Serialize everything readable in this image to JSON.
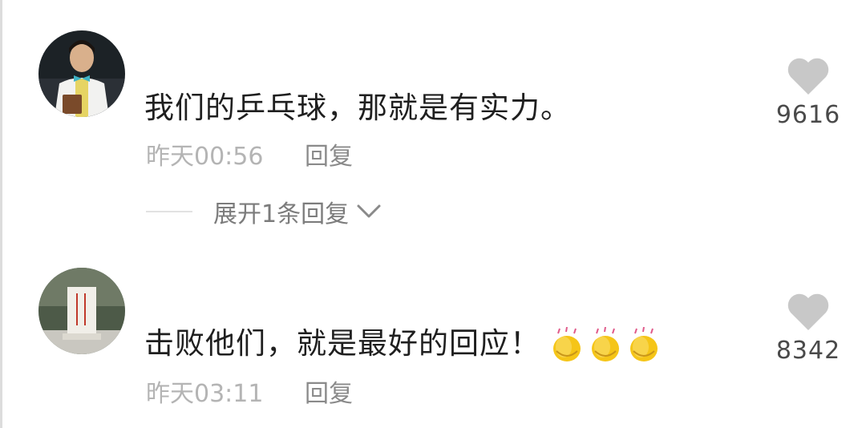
{
  "comments": [
    {
      "text": "我们的乒乓球，那就是有实力。",
      "time": "昨天00:56",
      "reply_label": "回复",
      "likes": "9616",
      "avatar": "person-bowtie-avatar"
    },
    {
      "text": "击败他们，就是最好的回应！",
      "emoji": [
        "clapping-hands-icon",
        "clapping-hands-icon",
        "clapping-hands-icon"
      ],
      "time": "昨天03:11",
      "reply_label": "回复",
      "likes": "8342",
      "avatar": "monument-avatar"
    }
  ],
  "expand_replies": {
    "label": "展开1条回复",
    "icon": "chevron-down-icon"
  },
  "colors": {
    "text": "#1f1f1f",
    "time": "#b4b4b4",
    "reply": "#8a8a8a",
    "heart": "#c8c8c8",
    "clap": "#f5c518"
  }
}
